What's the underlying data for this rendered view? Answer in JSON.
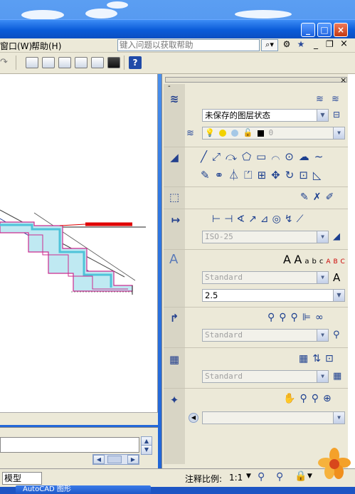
{
  "menu": {
    "window": "窗口(W)",
    "help": "帮助(H)"
  },
  "help_search": {
    "placeholder": "键入问题以获取帮助"
  },
  "title_controls": {
    "minimize": "_",
    "maximize": "□",
    "close": "×"
  },
  "doc_controls": {
    "minimize": "_",
    "restore": "❐",
    "close": "×"
  },
  "palette": {
    "layers": {
      "state": "未保存的图层状态",
      "current_layer": "0"
    },
    "dimension": {
      "style": "ISO-25"
    },
    "text": {
      "style": "Standard",
      "height": "2.5"
    },
    "multileader": {
      "style": "Standard"
    },
    "table": {
      "style": "Standard"
    }
  },
  "status": {
    "tab": "模型",
    "annotation_scale_label": "注释比例:",
    "annotation_scale": "1:1"
  },
  "taskbar": {
    "item": "AutoCAD 图形"
  },
  "colors": {
    "red_line": "#e00000",
    "accent_blue": "#0a5bd8",
    "cyan_fill": "#4fc3d9",
    "magenta": "#cc2b8f"
  },
  "icons": [
    "search-icon",
    "favorites-icon",
    "help-icon",
    "layer-icon",
    "line-icon",
    "circle-icon",
    "arc-icon",
    "move-icon",
    "rotate-icon",
    "text-icon",
    "dimension-icon",
    "table-icon",
    "navigate-icon",
    "zoom-icon",
    "lock-icon"
  ]
}
